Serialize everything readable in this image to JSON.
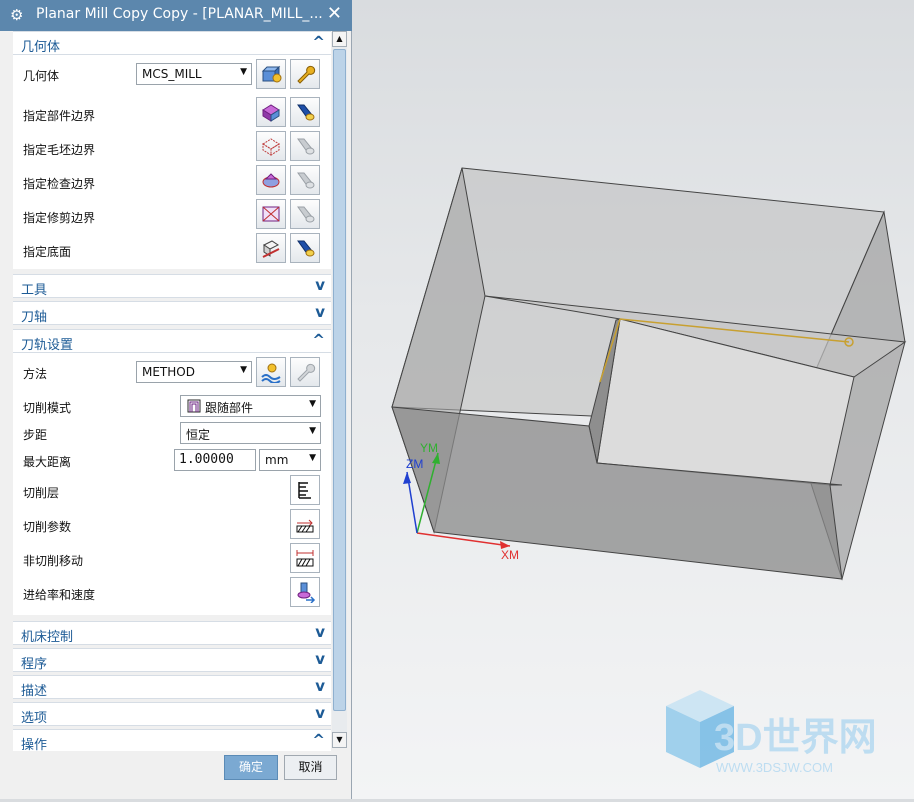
{
  "dialog": {
    "title": "Planar Mill Copy Copy - [PLANAR_MILL_...",
    "sections": {
      "geometry": {
        "label": "几何体",
        "geometry_row": {
          "label": "几何体",
          "value": "MCS_MILL"
        },
        "rows": [
          "指定部件边界",
          "指定毛坯边界",
          "指定检查边界",
          "指定修剪边界",
          "指定底面"
        ]
      },
      "tool": {
        "label": "工具"
      },
      "tool_axis": {
        "label": "刀轴"
      },
      "path_settings": {
        "label": "刀轨设置",
        "method": {
          "label": "方法",
          "value": "METHOD"
        },
        "cut_pattern": {
          "label": "切削模式",
          "value": "跟随部件"
        },
        "stepover": {
          "label": "步距",
          "value": "恒定"
        },
        "max_distance": {
          "label": "最大距离",
          "value": "1.00000",
          "unit": "mm"
        },
        "cut_levels": {
          "label": "切削层"
        },
        "cut_params": {
          "label": "切削参数"
        },
        "non_cutting": {
          "label": "非切削移动"
        },
        "feeds": {
          "label": "进给率和速度"
        }
      },
      "machine_control": {
        "label": "机床控制"
      },
      "program": {
        "label": "程序"
      },
      "description": {
        "label": "描述"
      },
      "options": {
        "label": "选项"
      },
      "actions": {
        "label": "操作"
      }
    },
    "ok_label": "确定",
    "cancel_label": "取消"
  },
  "viewport": {
    "axes": {
      "xm": "XM",
      "ym": "YM",
      "zm": "ZM"
    },
    "watermark": {
      "brand": "3D世界网",
      "url": "WWW.3DSJW.COM"
    }
  },
  "colors": {
    "title_bar": "#5c87ad",
    "section_text": "#1d5b96",
    "ok_button": "#7ba9d2",
    "model_edge": "#444444",
    "tool_path": "#c8a030"
  },
  "icons": [
    "gear-icon",
    "close-icon",
    "geometry-display-icon",
    "wrench-edit-icon",
    "part-boundary-icon",
    "flashlight-show-icon",
    "blank-boundary-icon",
    "check-boundary-icon",
    "trim-boundary-icon",
    "floor-icon",
    "method-new-icon",
    "cut-levels-icon",
    "cut-params-icon",
    "non-cutting-icon",
    "feeds-speeds-icon",
    "follow-part-icon",
    "cube-logo-icon"
  ]
}
